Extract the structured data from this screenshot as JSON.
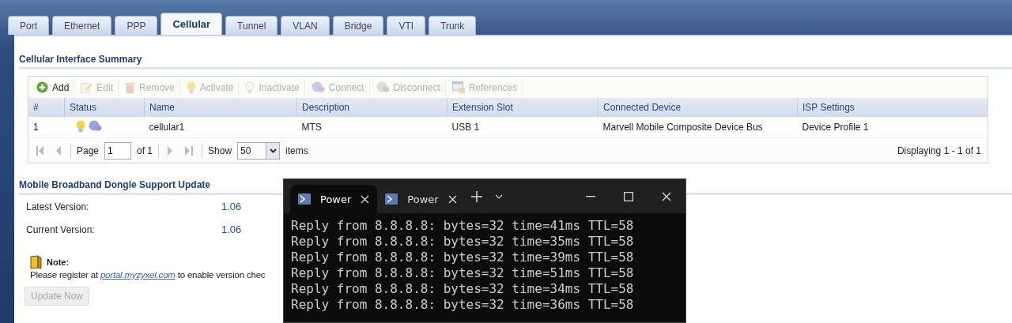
{
  "tabs": [
    {
      "label": "Port",
      "selected": false
    },
    {
      "label": "Ethernet",
      "selected": false
    },
    {
      "label": "PPP",
      "selected": false
    },
    {
      "label": "Cellular",
      "selected": true
    },
    {
      "label": "Tunnel",
      "selected": false
    },
    {
      "label": "VLAN",
      "selected": false
    },
    {
      "label": "Bridge",
      "selected": false
    },
    {
      "label": "VTI",
      "selected": false
    },
    {
      "label": "Trunk",
      "selected": false
    }
  ],
  "summary": {
    "title": "Cellular Interface Summary",
    "toolbar": [
      {
        "kind": "add",
        "label": "Add",
        "disabled": false
      },
      {
        "kind": "edit",
        "label": "Edit",
        "disabled": true
      },
      {
        "kind": "remove",
        "label": "Remove",
        "disabled": true
      },
      {
        "kind": "activate",
        "label": "Activate",
        "disabled": true
      },
      {
        "kind": "inactivate",
        "label": "Inactivate",
        "disabled": true
      },
      {
        "kind": "connect",
        "label": "Connect",
        "disabled": true
      },
      {
        "kind": "disconnect",
        "label": "Disconnect",
        "disabled": true
      },
      {
        "kind": "references",
        "label": "References",
        "disabled": true
      }
    ],
    "table": {
      "columns": [
        "#",
        "Status",
        "Name",
        "Description",
        "Extension Slot",
        "Connected Device",
        "ISP Settings"
      ],
      "rows": [
        {
          "cells": [
            "1",
            "",
            "cellular1",
            "MTS",
            "USB 1",
            "Marvell Mobile Composite Device Bus",
            "Device Profile 1"
          ],
          "active": true,
          "connected": true
        }
      ]
    },
    "pager": {
      "page_label": "Page",
      "page": "1",
      "of": "of 1",
      "show_label": "Show",
      "show": "50",
      "items_label": "items",
      "displaying": "Displaying 1 - 1 of 1"
    }
  },
  "update": {
    "title": "Mobile Broadband Dongle Support Update",
    "fields": [
      {
        "label": "Latest Version:",
        "value": "1.06"
      },
      {
        "label": "Current Version:",
        "value": "1.06"
      }
    ],
    "note_title": "Note:",
    "note_before": "Please register at ",
    "note_link": "portal.myzyxel.com",
    "note_after": " to enable version chec",
    "button": {
      "label": "Update Now",
      "disabled": true
    }
  },
  "terminal": {
    "tabs": [
      {
        "label": "Power",
        "selected": true
      },
      {
        "label": "Power",
        "selected": false
      }
    ],
    "lines": [
      "Reply from 8.8.8.8: bytes=32 time=41ms TTL=58",
      "Reply from 8.8.8.8: bytes=32 time=35ms TTL=58",
      "Reply from 8.8.8.8: bytes=32 time=39ms TTL=58",
      "Reply from 8.8.8.8: bytes=32 time=51ms TTL=58",
      "Reply from 8.8.8.8: bytes=32 time=34ms TTL=58",
      "Reply from 8.8.8.8: bytes=32 time=36ms TTL=58"
    ]
  }
}
